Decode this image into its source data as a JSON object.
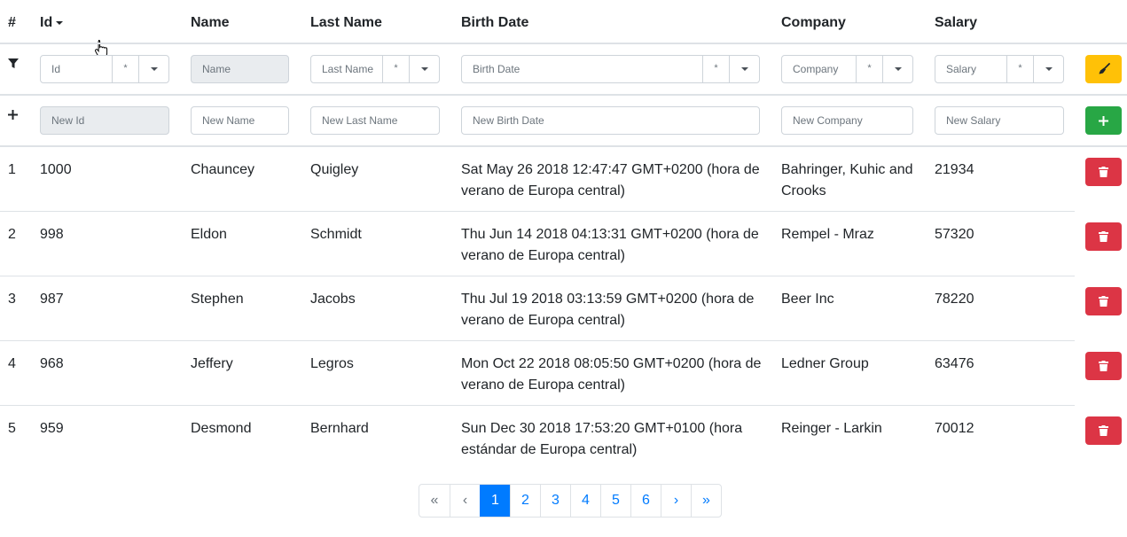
{
  "header": {
    "index": "#",
    "id": "Id",
    "name": "Name",
    "last_name": "Last Name",
    "birth_date": "Birth Date",
    "company": "Company",
    "salary": "Salary"
  },
  "filters": {
    "id": "Id",
    "name": "Name",
    "last_name": "Last Name",
    "birth_date": "Birth Date",
    "company": "Company",
    "salary": "Salary",
    "wildcard": "*"
  },
  "new_row": {
    "id": "New Id",
    "name": "New Name",
    "last_name": "New Last Name",
    "birth_date": "New Birth Date",
    "company": "New Company",
    "salary": "New Salary"
  },
  "rows": [
    {
      "index": "1",
      "id": "1000",
      "name": "Chauncey",
      "last_name": "Quigley",
      "birth1": "Sat May 26 2018 12:47:47 GMT+0200 (hora de",
      "birth2": "verano de Europa central)",
      "company1": "Bahringer, Kuhic and",
      "company2": "Crooks",
      "salary": "21934"
    },
    {
      "index": "2",
      "id": "998",
      "name": "Eldon",
      "last_name": "Schmidt",
      "birth1": "Thu Jun 14 2018 04:13:31 GMT+0200 (hora de",
      "birth2": "verano de Europa central)",
      "company1": "Rempel - Mraz",
      "company2": "",
      "salary": "57320"
    },
    {
      "index": "3",
      "id": "987",
      "name": "Stephen",
      "last_name": "Jacobs",
      "birth1": "Thu Jul 19 2018 03:13:59 GMT+0200 (hora de",
      "birth2": "verano de Europa central)",
      "company1": "Beer Inc",
      "company2": "",
      "salary": "78220"
    },
    {
      "index": "4",
      "id": "968",
      "name": "Jeffery",
      "last_name": "Legros",
      "birth1": "Mon Oct 22 2018 08:05:50 GMT+0200 (hora de",
      "birth2": "verano de Europa central)",
      "company1": "Ledner Group",
      "company2": "",
      "salary": "63476"
    },
    {
      "index": "5",
      "id": "959",
      "name": "Desmond",
      "last_name": "Bernhard",
      "birth1": "Sun Dec 30 2018 17:53:20 GMT+0100 (hora",
      "birth2": "estándar de Europa central)",
      "company1": "Reinger - Larkin",
      "company2": "",
      "salary": "70012"
    }
  ],
  "pagination": {
    "first": "«",
    "prev": "‹",
    "pages": [
      "1",
      "2",
      "3",
      "4",
      "5",
      "6"
    ],
    "next": "›",
    "last": "»",
    "active_page": "1"
  },
  "colors": {
    "warning": "#ffc107",
    "success": "#28a745",
    "danger": "#dc3545",
    "primary": "#007bff"
  }
}
